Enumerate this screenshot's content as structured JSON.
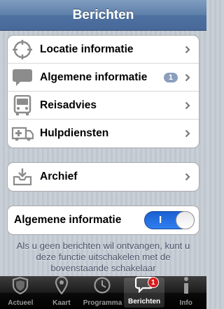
{
  "navbar": {
    "title": "Berichten"
  },
  "menu": {
    "items": [
      {
        "label": "Locatie informatie",
        "icon": "crosshair-icon"
      },
      {
        "label": "Algemene informatie",
        "icon": "speech-bubble-icon",
        "badge": "1"
      },
      {
        "label": "Reisadvies",
        "icon": "bus-icon"
      },
      {
        "label": "Hulpdiensten",
        "icon": "ambulance-icon"
      }
    ]
  },
  "archive": {
    "label": "Archief",
    "icon": "inbox-tray-icon"
  },
  "setting": {
    "label": "Algemene informatie",
    "switch_label": "I",
    "state": "on"
  },
  "note": "Als u geen berichten wil ontvangen, kunt u deze functie uitschakelen met de bovenstaande schakelaar",
  "tabs": [
    {
      "label": "Actueel",
      "icon": "shield-icon"
    },
    {
      "label": "Kaart",
      "icon": "map-pin-icon"
    },
    {
      "label": "Programma",
      "icon": "clock-icon"
    },
    {
      "label": "Berichten",
      "icon": "message-icon",
      "badge": "1",
      "active": true
    },
    {
      "label": "Info",
      "icon": "info-icon"
    }
  ],
  "colors": {
    "navbar": "#5d7fa9",
    "switch_on": "#2f7ff0",
    "badge_red": "#d81b1b",
    "badge_grey": "#8b9fbd"
  }
}
